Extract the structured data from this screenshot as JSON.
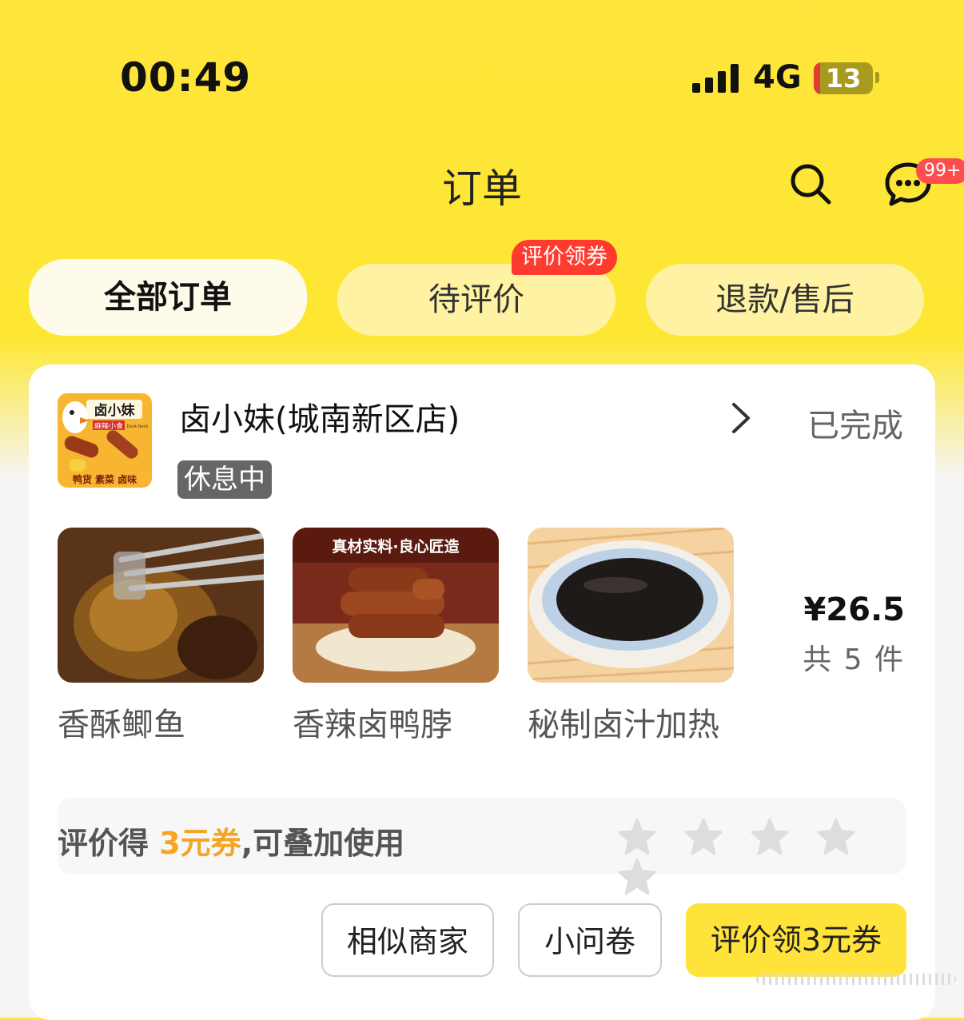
{
  "status_bar": {
    "time": "00:49",
    "network": "4G",
    "battery": "13"
  },
  "header": {
    "title": "订单",
    "message_badge": "99+"
  },
  "tabs": [
    {
      "label": "全部订单",
      "active": true
    },
    {
      "label": "待评价",
      "active": false,
      "badge": "评价领券"
    },
    {
      "label": "退款/售后",
      "active": false
    }
  ],
  "order": {
    "store": {
      "name": "卤小妹(城南新区店)",
      "status_badge": "休息中",
      "logo": {
        "title": "卤小妹",
        "subtitle": "麻辣小食",
        "tagline": "鸭货 素菜 卤味",
        "mini": "Duck Neck"
      }
    },
    "status": "已完成",
    "items": [
      {
        "name": "香酥鲫鱼"
      },
      {
        "name": "香辣卤鸭脖",
        "image_caption": "真材实料·良心匠造"
      },
      {
        "name": "秘制卤汁加热"
      }
    ],
    "price": "¥26.5",
    "quantity": "共 5 件",
    "review": {
      "prefix": "评价得 ",
      "highlight": "3元券",
      "suffix": ",可叠加使用",
      "stars": 5
    },
    "actions": {
      "similar": "相似商家",
      "survey": "小问卷",
      "review": "评价领3元券"
    }
  },
  "colors": {
    "accent": "#ffe33a",
    "badge_red": "#ff3b30",
    "highlight": "#f5a524"
  }
}
